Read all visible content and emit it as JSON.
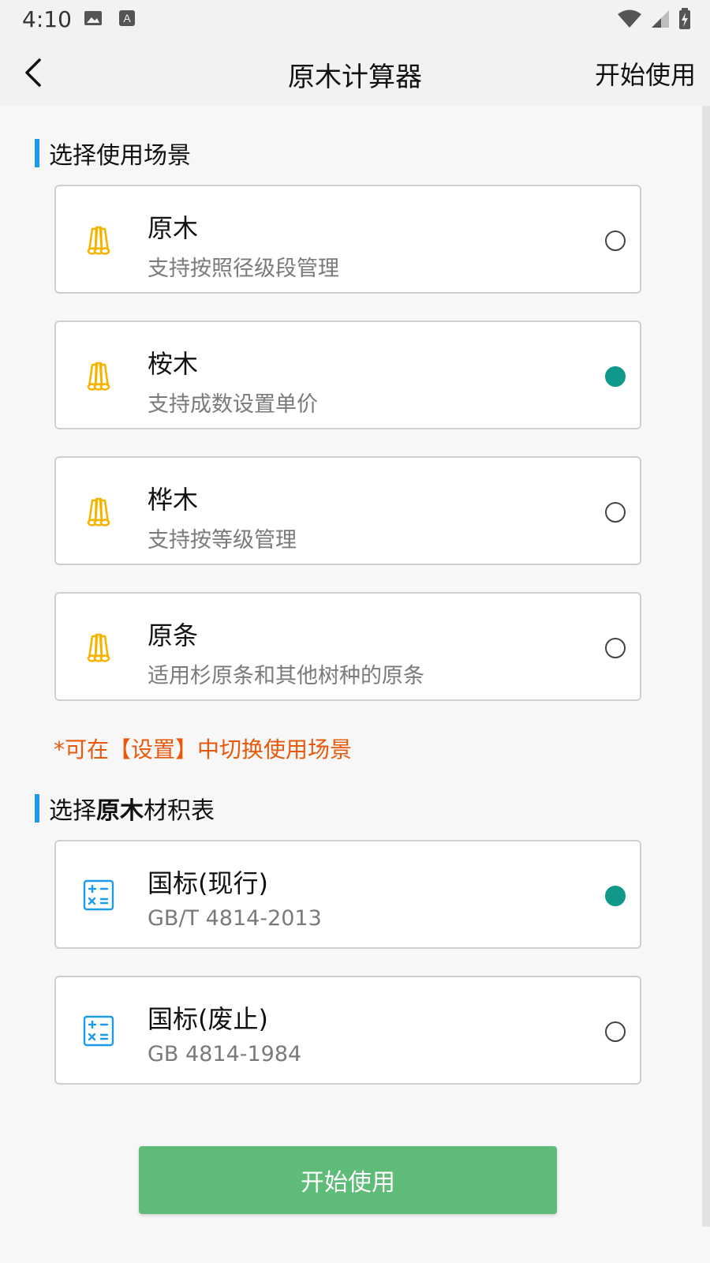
{
  "status": {
    "time": "4:10"
  },
  "app_bar": {
    "title": "原木计算器",
    "action": "开始使用"
  },
  "section1": {
    "title": "选择使用场景",
    "options": [
      {
        "title": "原木",
        "subtitle": "支持按照径级段管理",
        "selected": false,
        "icon": "logs-icon"
      },
      {
        "title": "桉木",
        "subtitle": "支持成数设置单价",
        "selected": true,
        "icon": "logs-icon"
      },
      {
        "title": "桦木",
        "subtitle": "支持按等级管理",
        "selected": false,
        "icon": "logs-icon"
      },
      {
        "title": "原条",
        "subtitle": "适用杉原条和其他树种的原条",
        "selected": false,
        "icon": "logs-icon"
      }
    ]
  },
  "note": "*可在【设置】中切换使用场景",
  "section2": {
    "title_prefix": "选择",
    "title_bold": "原木",
    "title_suffix": "材积表",
    "options": [
      {
        "title": "国标(现行)",
        "subtitle": "GB/T 4814-2013",
        "selected": true,
        "icon": "calculator-icon"
      },
      {
        "title": "国标(废止)",
        "subtitle": "GB 4814-1984",
        "selected": false,
        "icon": "calculator-icon"
      }
    ]
  },
  "button": {
    "label": "开始使用"
  },
  "colors": {
    "accent": "#10988a",
    "section_bar": "#1e9be8",
    "note": "#e8590c",
    "button": "#5fbb78",
    "icon_logs": "#f5b400",
    "icon_calc": "#1e9be8"
  }
}
